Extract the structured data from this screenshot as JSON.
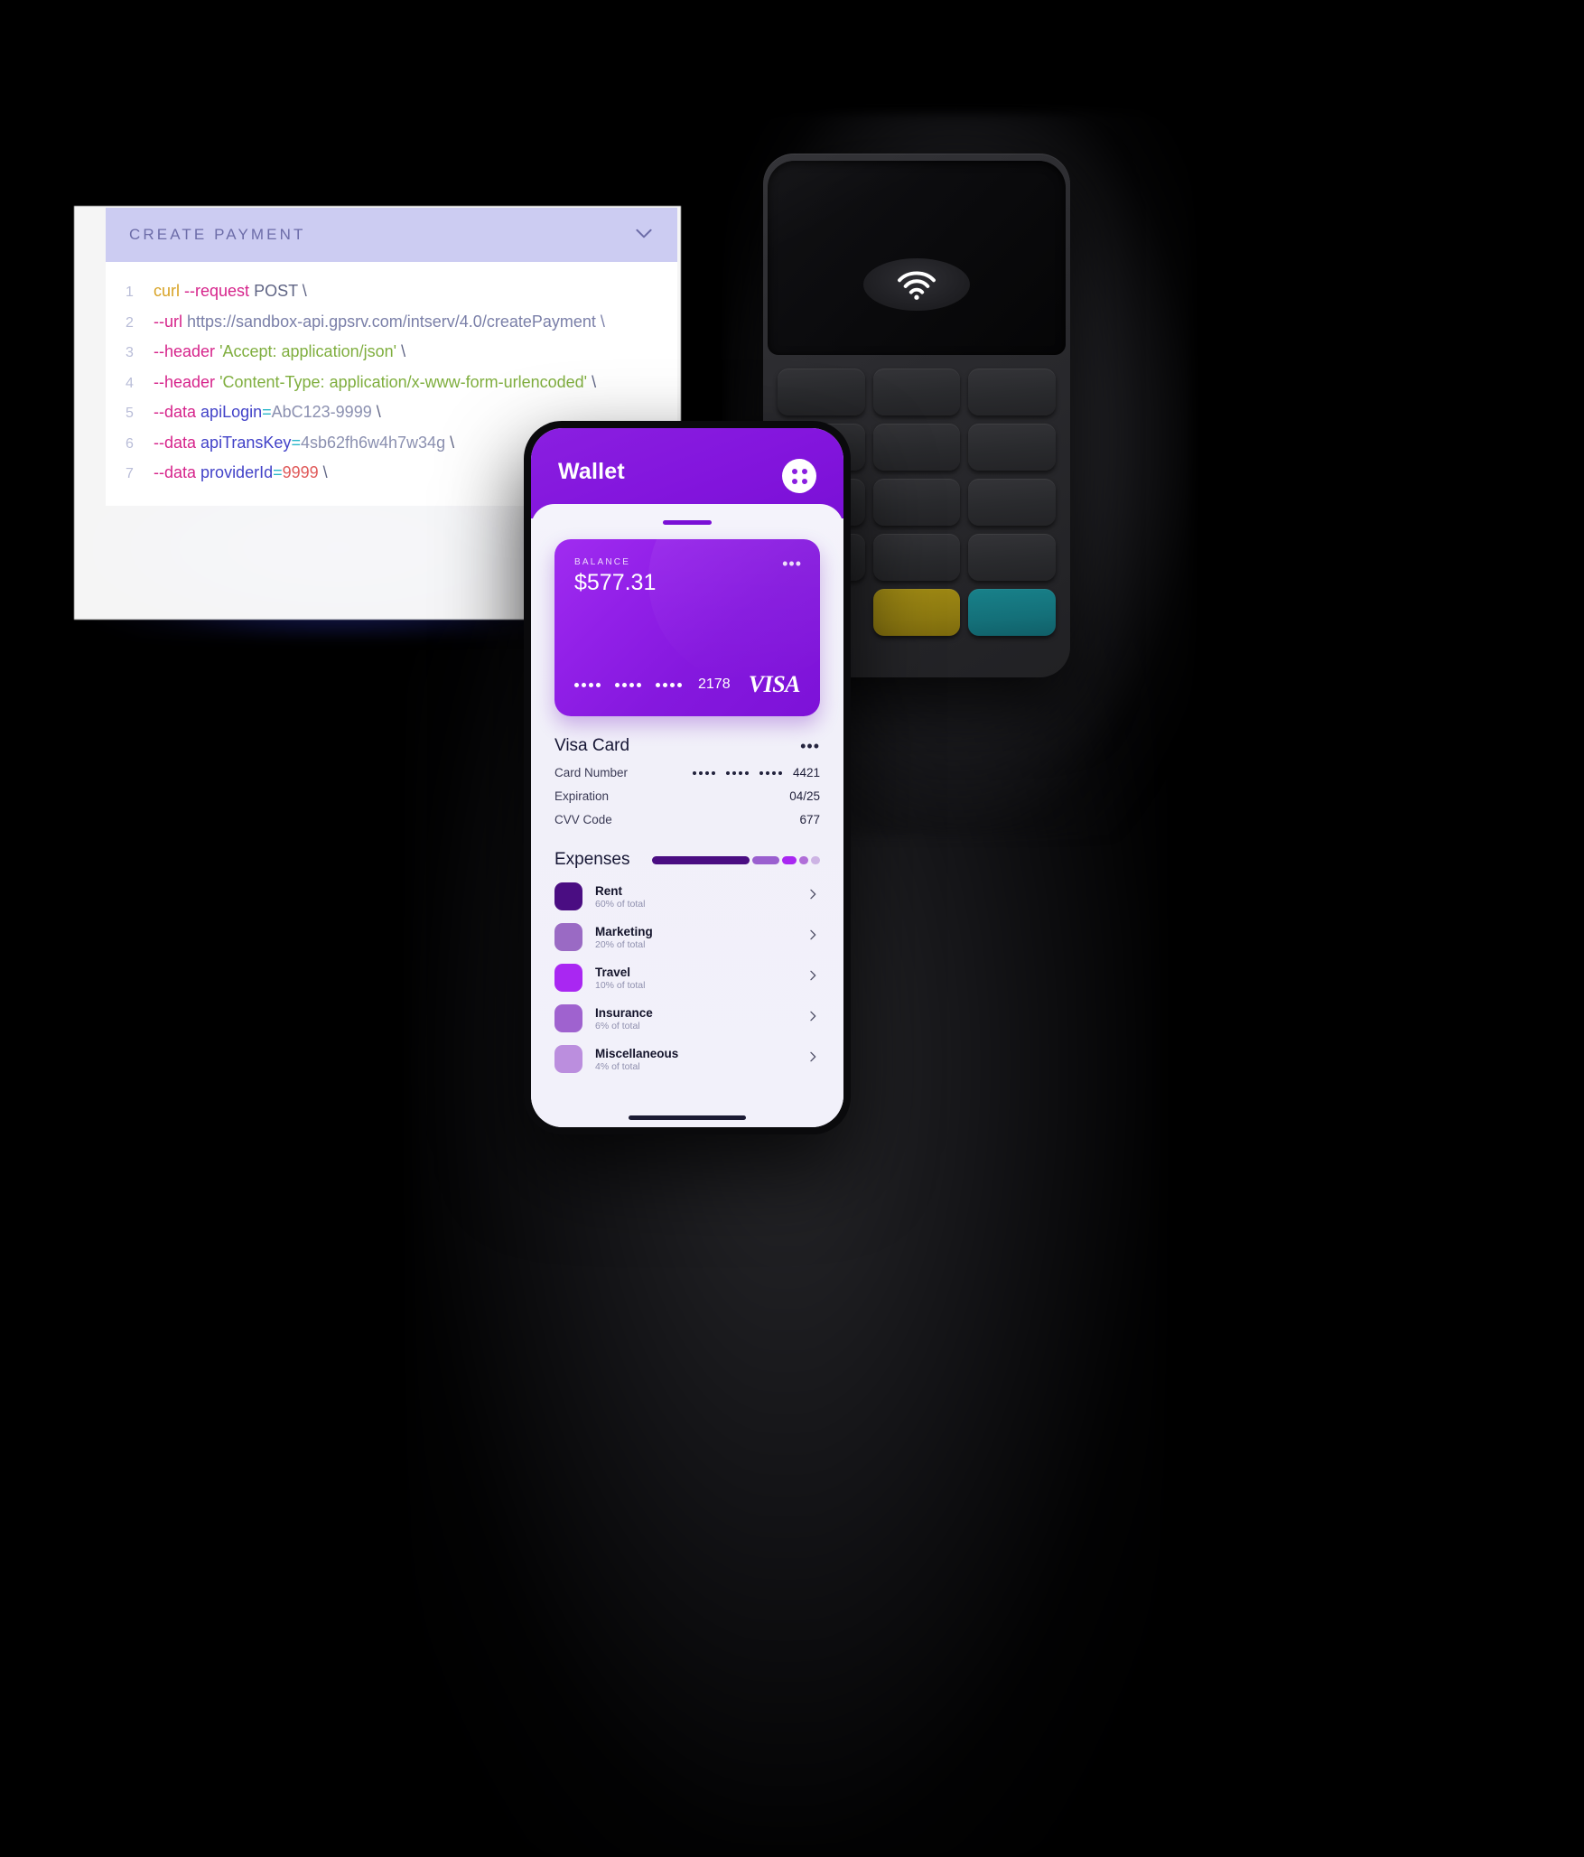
{
  "code_panel": {
    "title": "CREATE PAYMENT",
    "collapse_icon": "chevron-down-icon",
    "lines": [
      {
        "n": "1",
        "segments": [
          {
            "t": "curl",
            "c": "cmd"
          },
          {
            "t": " ",
            "c": "plain"
          },
          {
            "t": "--request",
            "c": "flag"
          },
          {
            "t": " POST \\",
            "c": "plain"
          }
        ]
      },
      {
        "n": "2",
        "segments": [
          {
            "t": "  ",
            "c": "plain"
          },
          {
            "t": "--url",
            "c": "flag"
          },
          {
            "t": " https://sandbox-api.gpsrv.com/intserv/4.0/createPayment \\",
            "c": "url"
          }
        ]
      },
      {
        "n": "3",
        "segments": [
          {
            "t": "  ",
            "c": "plain"
          },
          {
            "t": "--header",
            "c": "flag"
          },
          {
            "t": " ",
            "c": "plain"
          },
          {
            "t": "'Accept: application/json'",
            "c": "str"
          },
          {
            "t": " \\",
            "c": "plain"
          }
        ]
      },
      {
        "n": "4",
        "segments": [
          {
            "t": "  ",
            "c": "plain"
          },
          {
            "t": "--header",
            "c": "flag"
          },
          {
            "t": " ",
            "c": "plain"
          },
          {
            "t": "'Content-Type: application/x-www-form-urlencoded'",
            "c": "str"
          },
          {
            "t": " \\",
            "c": "plain"
          }
        ]
      },
      {
        "n": "5",
        "segments": [
          {
            "t": "  ",
            "c": "plain"
          },
          {
            "t": "--data",
            "c": "flag"
          },
          {
            "t": " ",
            "c": "plain"
          },
          {
            "t": "apiLogin",
            "c": "key"
          },
          {
            "t": "=",
            "c": "eq"
          },
          {
            "t": "AbC123-9999",
            "c": "val"
          },
          {
            "t": " \\",
            "c": "plain"
          }
        ]
      },
      {
        "n": "6",
        "segments": [
          {
            "t": "  ",
            "c": "plain"
          },
          {
            "t": "--data",
            "c": "flag"
          },
          {
            "t": " ",
            "c": "plain"
          },
          {
            "t": "apiTransKey",
            "c": "key"
          },
          {
            "t": "=",
            "c": "eq"
          },
          {
            "t": "4sb62fh6w4h7w34g",
            "c": "val"
          },
          {
            "t": " \\",
            "c": "plain"
          }
        ]
      },
      {
        "n": "7",
        "segments": [
          {
            "t": "  ",
            "c": "plain"
          },
          {
            "t": "--data",
            "c": "flag"
          },
          {
            "t": " ",
            "c": "plain"
          },
          {
            "t": "providerId",
            "c": "key"
          },
          {
            "t": "=",
            "c": "eq"
          },
          {
            "t": "9999",
            "c": "num"
          },
          {
            "t": " \\",
            "c": "plain"
          }
        ]
      }
    ]
  },
  "phone": {
    "app_title": "Wallet",
    "menu_icon": "grid-dots-icon",
    "card": {
      "balance_label": "BALANCE",
      "balance_amount": "$577.31",
      "more_icon": "more-horizontal-icon",
      "last4": "2178",
      "brand": "VISA",
      "accent": "#8a1fe0"
    },
    "card_section": {
      "title": "Visa Card",
      "more_icon": "more-horizontal-icon",
      "rows": [
        {
          "label": "Card Number",
          "value": "4421",
          "masked": true
        },
        {
          "label": "Expiration",
          "value": "04/25",
          "masked": false
        },
        {
          "label": "CVV Code",
          "value": "677",
          "masked": false
        }
      ]
    },
    "expenses": {
      "title": "Expenses",
      "bars": [
        {
          "width": 108,
          "color": "#4a0d82"
        },
        {
          "width": 30,
          "color": "#9a5fcf"
        },
        {
          "width": 16,
          "color": "#a927f2"
        },
        {
          "width": 10,
          "color": "#b06ed8"
        },
        {
          "width": 10,
          "color": "#cdb4e4"
        }
      ],
      "items": [
        {
          "name": "Rent",
          "sub": "60% of total",
          "color": "#4a0d82",
          "chevron": "chevron-right-icon"
        },
        {
          "name": "Marketing",
          "sub": "20% of total",
          "color": "#9a6ac4",
          "chevron": "chevron-right-icon"
        },
        {
          "name": "Travel",
          "sub": "10% of total",
          "color": "#a927f2",
          "chevron": "chevron-right-icon"
        },
        {
          "name": "Insurance",
          "sub": "6% of total",
          "color": "#9f62cf",
          "chevron": "chevron-right-icon"
        },
        {
          "name": "Miscellaneous",
          "sub": "4% of total",
          "color": "#bb8ede",
          "chevron": "chevron-right-icon"
        }
      ]
    }
  },
  "terminal": {
    "nfc_icon": "contactless-wifi-icon",
    "keys": [
      {
        "type": "normal"
      },
      {
        "type": "normal"
      },
      {
        "type": "normal"
      },
      {
        "type": "normal"
      },
      {
        "type": "normal"
      },
      {
        "type": "normal"
      },
      {
        "type": "normal"
      },
      {
        "type": "normal"
      },
      {
        "type": "normal"
      },
      {
        "type": "normal"
      },
      {
        "type": "normal"
      },
      {
        "type": "normal"
      },
      {
        "type": "blank"
      },
      {
        "type": "yellow"
      },
      {
        "type": "teal"
      }
    ]
  }
}
